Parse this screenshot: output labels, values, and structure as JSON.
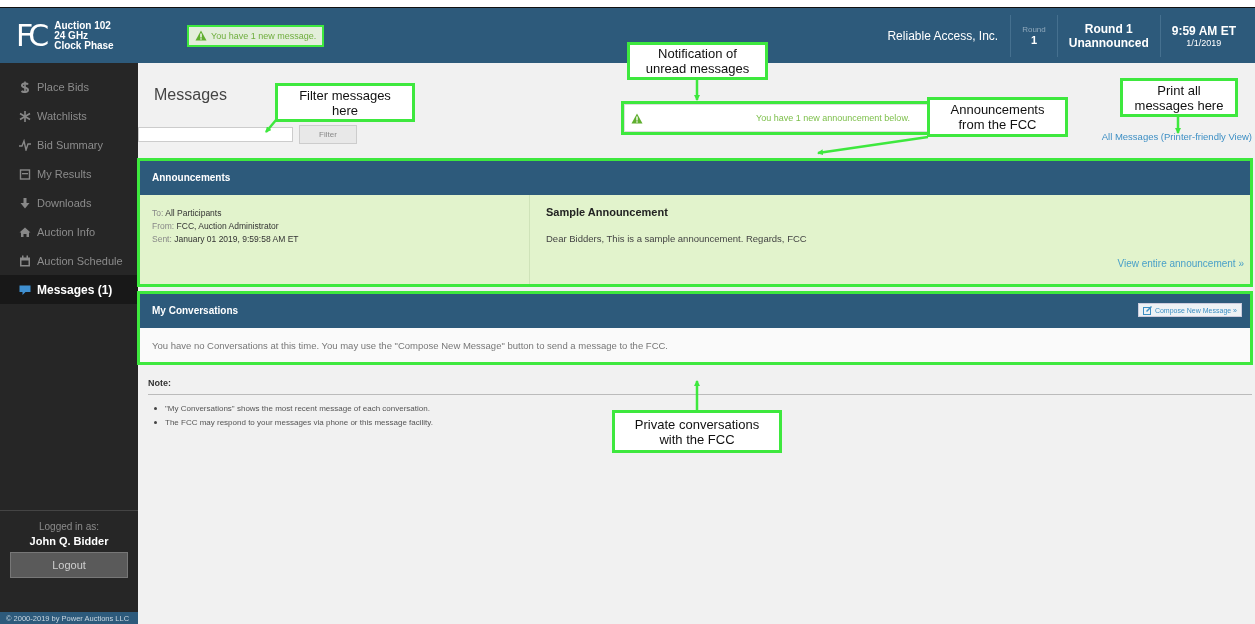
{
  "header": {
    "logo": "FC",
    "auction_lines": [
      "Auction 102",
      "24 GHz",
      "Clock Phase"
    ],
    "notification": {
      "text": "You have 1 new message.",
      "highlighted": true
    },
    "bidder": "Reliable Access, Inc.",
    "round": {
      "label": "Round",
      "value": "1"
    },
    "status": [
      "Round 1",
      "Unannounced"
    ],
    "clock": {
      "time": "9:59 AM ET",
      "date": "1/1/2019"
    }
  },
  "sidebar": {
    "items": [
      {
        "label": "Place Bids",
        "selected": false
      },
      {
        "label": "Watchlists",
        "selected": false
      },
      {
        "label": "Bid Summary",
        "selected": false
      },
      {
        "label": "My Results",
        "selected": false
      },
      {
        "label": "Downloads",
        "selected": false
      },
      {
        "label": "Auction Info",
        "selected": false
      },
      {
        "label": "Auction Schedule",
        "selected": false
      },
      {
        "label": "Messages (1)",
        "selected": true
      }
    ],
    "logged_in_label": "Logged in as:",
    "user": "John Q. Bidder",
    "logout": "Logout",
    "copyright": "© 2000-2019 by Power Auctions LLC"
  },
  "page": {
    "title": "Messages",
    "filter_button": "Filter",
    "alert": {
      "text": "You have 1 new announcement below.",
      "highlighted": true
    },
    "print_link": "All Messages (Printer-friendly View)"
  },
  "announcements": {
    "title": "Announcements",
    "highlighted": true,
    "items": [
      {
        "meta": [
          "To: **All Participants**",
          "From: **FCC, Auction Administrator**",
          "Sent: **January 01 2019,  9:59:58 AM ET**"
        ],
        "subject": "Sample Announcement",
        "body": "Dear Bidders, This is a sample announcement. Regards, FCC",
        "link": "View entire announcement »"
      }
    ]
  },
  "conversations": {
    "title": "My Conversations",
    "highlighted": true,
    "compose": "Compose New Message »",
    "empty_text": "You have no Conversations at this time. You may use the \"Compose New Message\" button to send a message to the FCC."
  },
  "note": {
    "title": "Note:",
    "items": [
      "\"My Conversations\" shows the most recent message of each conversation.",
      "The FCC may respond to your messages via phone or this message facility."
    ]
  },
  "callouts": [
    {
      "text": "Filter messages\nhere"
    },
    {
      "text": "Notification of\nunread messages"
    },
    {
      "text": "Announcements\nfrom the FCC"
    },
    {
      "text": "Print all\nmessages here"
    },
    {
      "text": "Private conversations\nwith the FCC"
    }
  ]
}
